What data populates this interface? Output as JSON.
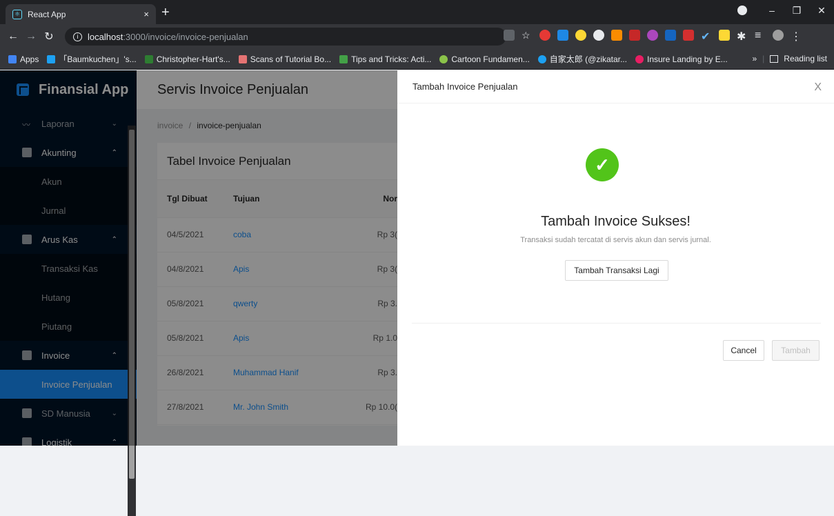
{
  "browser": {
    "tab_title": "React App",
    "tab_close": "×",
    "new_tab": "+",
    "url_host": "localhost",
    "url_path": ":3000/invoice/invoice-penjualan",
    "bookmarks": [
      {
        "label": "Apps",
        "color": "#4285f4"
      },
      {
        "label": "「Baumkuchen」's...",
        "color": "#1da1f2"
      },
      {
        "label": "Christopher-Hart's...",
        "color": "#2e7d32"
      },
      {
        "label": "Scans of Tutorial Bo...",
        "color": "#e57373"
      },
      {
        "label": "Tips and Tricks: Acti...",
        "color": "#43a047"
      },
      {
        "label": "Cartoon Fundamen...",
        "color": "#8bc34a"
      },
      {
        "label": "自家太郎 (@zikatar...",
        "color": "#1da1f2"
      },
      {
        "label": "Insure Landing by E...",
        "color": "#e91e63"
      }
    ],
    "bookmarks_more": "»",
    "reading_list": "Reading list"
  },
  "app": {
    "brand": "Finansial App",
    "page_title": "Servis Invoice Penjualan",
    "breadcrumb_root": "invoice",
    "breadcrumb_sep": "/",
    "breadcrumb_current": "invoice-penjualan",
    "menu": {
      "laporan": "Laporan",
      "akunting": "Akunting",
      "akun": "Akun",
      "jurnal": "Jurnal",
      "arus_kas": "Arus Kas",
      "transaksi_kas": "Transaksi Kas",
      "hutang": "Hutang",
      "piutang": "Piutang",
      "invoice": "Invoice",
      "invoice_penjualan": "Invoice Penjualan",
      "sd_manusia": "SD Manusia",
      "logistik": "Logistik"
    },
    "table": {
      "title": "Tabel Invoice Penjualan",
      "headers": [
        "Tgl Dibuat",
        "Tujuan",
        "Nor"
      ],
      "rows": [
        {
          "date": "04/5/2021",
          "tujuan": "coba",
          "nominal": "Rp 3("
        },
        {
          "date": "04/8/2021",
          "tujuan": "Apis",
          "nominal": "Rp 3("
        },
        {
          "date": "05/8/2021",
          "tujuan": "qwerty",
          "nominal": "Rp 3."
        },
        {
          "date": "05/8/2021",
          "tujuan": "Apis",
          "nominal": "Rp 1.0"
        },
        {
          "date": "26/8/2021",
          "tujuan": "Muhammad Hanif",
          "nominal": "Rp 3."
        },
        {
          "date": "27/8/2021",
          "tujuan": "Mr. John Smith",
          "nominal": "Rp 10.0("
        }
      ]
    }
  },
  "drawer": {
    "title": "Tambah Invoice Penjualan",
    "close": "X",
    "result_title": "Tambah Invoice Sukses!",
    "result_subtitle": "Transaksi sudah tercatat di servis akun dan servis jurnal.",
    "again_button": "Tambah Transaksi Lagi",
    "cancel_button": "Cancel",
    "submit_button": "Tambah"
  }
}
